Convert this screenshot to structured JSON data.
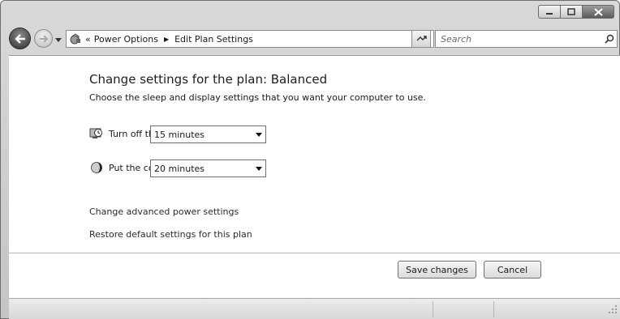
{
  "window": {
    "caption": {
      "minimize_icon": "minimize-icon",
      "maximize_icon": "maximize-icon",
      "close_icon": "close-icon"
    }
  },
  "navbar": {
    "back_icon": "back-arrow-icon",
    "forward_icon": "forward-arrow-icon",
    "breadcrumb": {
      "overflow": "«",
      "items": [
        "Power Options",
        "Edit Plan Settings"
      ],
      "separator": "▶"
    },
    "search": {
      "placeholder": "Search"
    }
  },
  "content": {
    "title": "Change settings for the plan: Balanced",
    "subtitle": "Choose the sleep and display settings that you want your computer to use.",
    "settings": [
      {
        "label": "Turn off the display:",
        "value": "15 minutes",
        "icon": "monitor-icon"
      },
      {
        "label": "Put the computer to sleep:",
        "value": "20 minutes",
        "icon": "moon-icon"
      }
    ],
    "links": {
      "advanced": "Change advanced power settings",
      "restore": "Restore default settings for this plan"
    },
    "buttons": {
      "save": "Save changes",
      "cancel": "Cancel"
    }
  },
  "colors": {
    "chrome": "#cfcfcf",
    "content_bg": "#ffffff",
    "text": "#1a1a1a"
  }
}
